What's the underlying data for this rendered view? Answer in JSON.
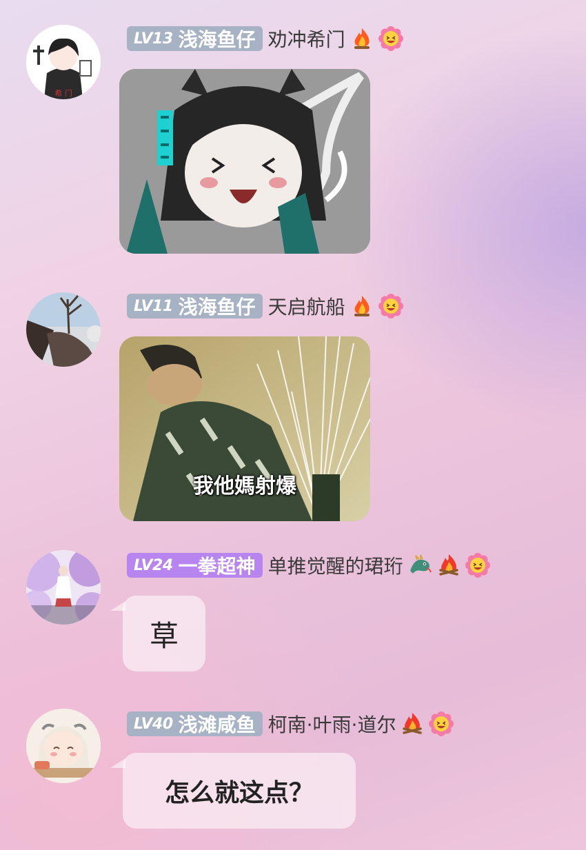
{
  "messages": [
    {
      "level": "LV13",
      "nickname": "浅海鱼仔",
      "title": "劝冲希门",
      "avatar_text": "希 门",
      "badges": [
        "fire-icon",
        "laughing-flower-icon"
      ],
      "content_type": "sticker"
    },
    {
      "level": "LV11",
      "nickname": "浅海鱼仔",
      "title": "天启航船",
      "badges": [
        "fire-icon",
        "laughing-flower-icon"
      ],
      "content_type": "image",
      "image_caption": "我他媽射爆"
    },
    {
      "level": "LV24",
      "nickname": "一拳超神",
      "title": "单推觉醒的珺珩",
      "badges": [
        "dragon-icon",
        "bonfire-icon",
        "laughing-flower-icon"
      ],
      "content_type": "text",
      "text": "草"
    },
    {
      "level": "LV40",
      "nickname": "浅滩咸鱼",
      "title": "柯南·叶雨·道尔",
      "badges": [
        "bonfire-icon",
        "laughing-flower-icon"
      ],
      "content_type": "text",
      "text": "怎么就这点？"
    }
  ],
  "colors": {
    "level_badge_gray": "#a7b2c5",
    "level_badge_purple": "#b884ef",
    "bubble": "rgba(255,255,255,0.55)"
  }
}
